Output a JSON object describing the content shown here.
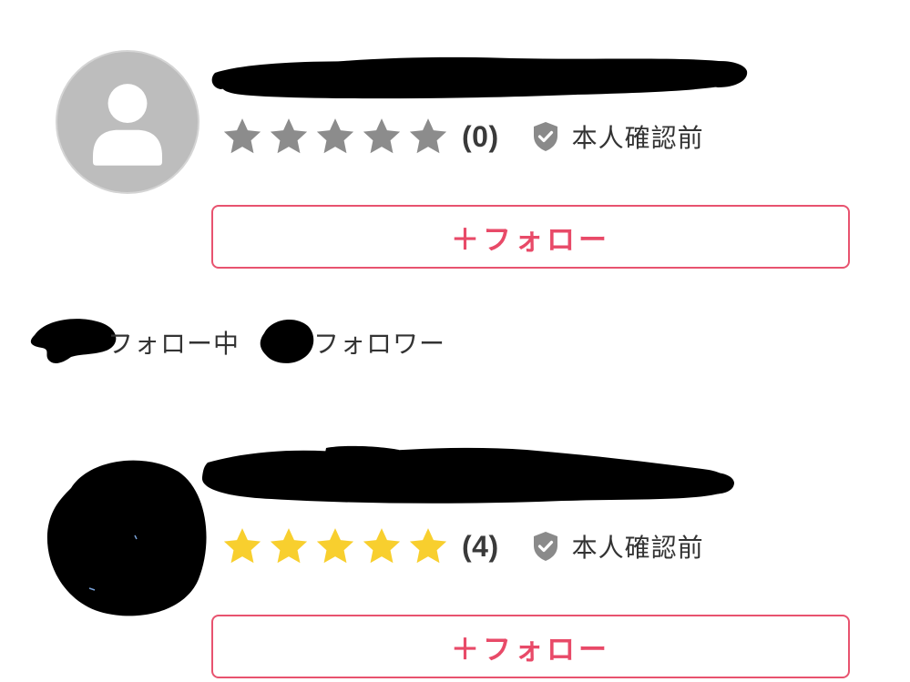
{
  "profiles": [
    {
      "rating": {
        "stars_filled": 0,
        "stars_total": 5,
        "review_count": "(0)"
      },
      "verification": {
        "label": "本人確認前",
        "icon": "shield-check-icon"
      },
      "follow_button": {
        "label": "＋フォロー"
      }
    },
    {
      "rating": {
        "stars_filled": 5,
        "stars_total": 5,
        "review_count": "(4)"
      },
      "verification": {
        "label": "本人確認前",
        "icon": "shield-check-icon"
      },
      "follow_button": {
        "label": "＋フォロー"
      }
    }
  ],
  "follow_stats": {
    "following_label": "フォロー中",
    "followers_label": "フォロワー"
  },
  "colors": {
    "accent": "#e84a68",
    "star_filled": "#f8cf2e",
    "star_empty": "#8c8c8c",
    "shield": "#8a8a8a",
    "avatar_bg": "#bdbdbd",
    "redaction": "#000000"
  }
}
